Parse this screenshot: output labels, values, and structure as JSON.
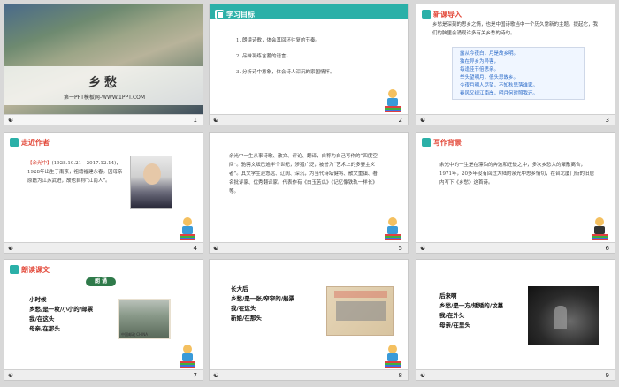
{
  "slides": [
    {
      "page": "1",
      "title": "乡愁",
      "subtitle": "第一PPT模板网-WWW.1PPT.COM"
    },
    {
      "page": "2",
      "header": "学习目标",
      "items": [
        "1. 朗读诗歌，体会其回环往复的节奏。",
        "2. 品味凝练含蓄的语言。",
        "3. 分析诗中意象，体会诗人深沉的家国情怀。"
      ]
    },
    {
      "page": "3",
      "header": "新课导入",
      "intro": "乡愁是深刻的思乡之情，也是中国诗歌当中一个历久常新的主题。提起它，我们的脑里会涌现许多有关乡愁的诗句。",
      "poems": [
        "露从今夜白，月是故乡明。",
        "独在异乡为异客，",
        "每逢佳节倍思亲。",
        "举头望明月，低头思故乡。",
        "今夜月明人尽望，不知秋思落谁家。",
        "春风又绿江南岸，明月何时照我还。"
      ]
    },
    {
      "page": "4",
      "header": "走近作者",
      "bio_name": "【余光中】",
      "bio": "(1928.10.21—2017.12.14)，1928年出生于南京，祖籍福建永春。因母亲原籍为江苏武进，故也自称“江南人”。"
    },
    {
      "page": "5",
      "text": "余光中一生从事诗歌、散文、评论、翻译，自称为自己写作的“四度空间”。驰骋文坛已逾半个世纪，涉猎广泛，被誉为“艺术上的多妻主义者”。其文学生涯悠远、辽阔、深沉，为当代诗坛健将、散文重镇、著名批评家、优秀翻译家。代表作有《白玉苦瓜》《记忆像铁轨一样长》等。"
    },
    {
      "page": "6",
      "header": "写作背景",
      "text": "余光中的一生是在漂泊的奔波和迁徙之中，多次乡愁入的聚散离合，1971年，20多年没有回过大陆的余光中思乡情切，在台北厦门街的旧居内写下《乡愁》这首诗。"
    },
    {
      "page": "7",
      "header": "朗读课文",
      "pill": "朗 诵",
      "lines": [
        "小时候",
        "乡愁/是一枚/小小的/邮票",
        "我/在这头",
        "母亲/在那头"
      ],
      "stamp_label": "中国邮政  CHINA"
    },
    {
      "page": "8",
      "lines": [
        "长大后",
        "乡愁/是一张/窄窄的/船票",
        "我/在这头",
        "新娘/在那头"
      ]
    },
    {
      "page": "9",
      "lines": [
        "后来啊",
        "乡愁/是一方/矮矮的/坟墓",
        "我/在外头",
        "母亲/在里头"
      ]
    }
  ],
  "footer_mark": "☯",
  "colors": {
    "accent": "#2bb0a8",
    "title_red": "#e34b3c",
    "poem_blue": "#2a6ac8"
  }
}
